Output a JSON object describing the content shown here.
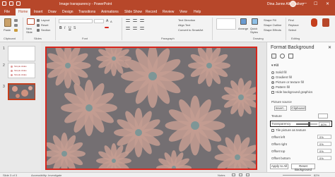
{
  "window": {
    "title": "Image transparency  -  PowerPoint",
    "user_name": "Dina Janne Alkey-alkey",
    "minimize": "—",
    "maximize": "☐",
    "close": "✕"
  },
  "tabs": [
    "File",
    "Home",
    "Insert",
    "Draw",
    "Design",
    "Transitions",
    "Animations",
    "Slide Show",
    "Record",
    "Review",
    "View",
    "Help"
  ],
  "active_tab": "Home",
  "ribbon": {
    "clipboard": {
      "paste": "Paste",
      "label": "Clipboard"
    },
    "slides": {
      "new_slide": "New Slide",
      "layout": "Layout",
      "reset": "Reset",
      "section": "Section",
      "label": "Slides"
    },
    "font": {
      "label": "Font"
    },
    "paragraph": {
      "text_direction": "Text Direction",
      "align_text": "Align Text",
      "convert_smartart": "Convert to SmartArt",
      "label": "Paragraph"
    },
    "drawing": {
      "arrange": "Arrange",
      "quick_styles": "Quick Styles",
      "shape_fill": "Shape Fill",
      "shape_outline": "Shape Outline",
      "shape_effects": "Shape Effects",
      "label": "Drawing"
    },
    "editing": {
      "find": "Find",
      "replace": "Replace",
      "select": "Select",
      "label": "Editing"
    }
  },
  "thumbnails": {
    "numbers": [
      "1",
      "2",
      "3"
    ],
    "slide2_lines": [
      "Simple slides",
      "Simple slides",
      "Simple slides"
    ]
  },
  "format_panel": {
    "title": "Format Background",
    "close": "✕",
    "section_fill": "Fill",
    "options": {
      "solid": "Solid fill",
      "gradient": "Gradient fill",
      "picture": "Picture or texture fill",
      "pattern": "Pattern fill",
      "hide": "Hide background graphics"
    },
    "picture_source": "Picture source",
    "insert": "Insert...",
    "clipboard": "Clipboard",
    "texture": "Texture",
    "transparency_label": "Transparency",
    "transparency_value": "60%",
    "transparency_level": 0.6,
    "tile": "Tile picture as texture",
    "offsets": [
      {
        "label": "Offset left",
        "value": "0%"
      },
      {
        "label": "Offset right",
        "value": "0%"
      },
      {
        "label": "Offset top",
        "value": "0%"
      },
      {
        "label": "Offset bottom",
        "value": "0%"
      }
    ],
    "apply_all": "Apply to All",
    "reset": "Reset Background"
  },
  "status": {
    "slide": "Slide 3 of 3",
    "accessibility": "Accessibility: Investigate",
    "notes": "Notes",
    "zoom": "82%"
  },
  "colors": {
    "accent": "#b7472a",
    "slide_border": "#d9261c",
    "transparency_highlight": "#111111"
  }
}
